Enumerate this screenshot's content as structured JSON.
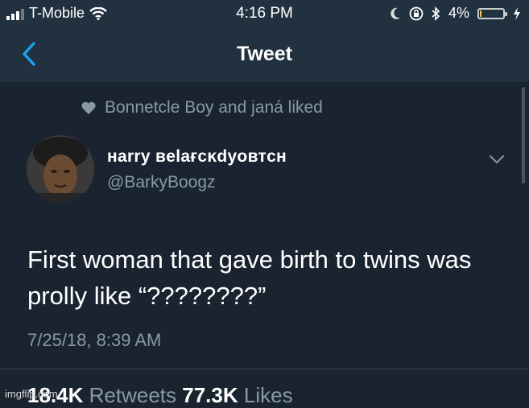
{
  "status_bar": {
    "carrier": "T-Mobile",
    "time": "4:16 PM",
    "battery": "4%",
    "battery_level": 0.04
  },
  "nav": {
    "title": "Tweet"
  },
  "social_context": "Bonnetcle Boy and janá liked",
  "tweet": {
    "display_name": "нarry вelaғcĸdyoвтcн",
    "handle": "@BarkyBoogz",
    "text_line1": "First woman that gave birth to twins was",
    "text_line2": "prolly like “????????”",
    "timestamp": "7/25/18, 8:39 AM",
    "retweets_count": "18.4K",
    "retweets_label": "Retweets",
    "likes_count": "77.3K",
    "likes_label": "Likes"
  },
  "watermark": "imgflip.com",
  "icons": {
    "signal": "signal-bars-icon",
    "wifi": "wifi-icon",
    "do_not_disturb": "moon-icon",
    "rotation_lock": "rotation-lock-icon",
    "bluetooth": "bluetooth-icon",
    "battery": "battery-icon",
    "charging": "charging-bolt-icon",
    "back": "chevron-left-icon",
    "liked": "heart-icon",
    "more": "chevron-down-icon"
  },
  "colors": {
    "accent": "#1da1f2",
    "secondary_text": "#8899a6",
    "background": "#1a2430",
    "header": "#223140"
  }
}
